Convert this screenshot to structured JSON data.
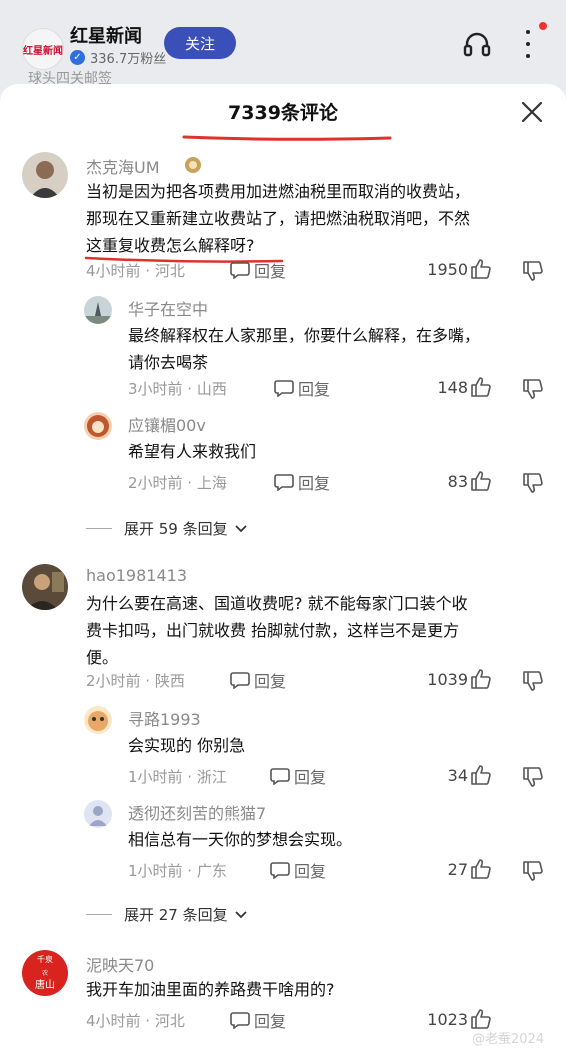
{
  "header": {
    "logo_text": "红星新闻",
    "app_name": "红星新闻",
    "fans": "336.7万粉丝",
    "follow_label": "关注",
    "behind_text": "球头四关邮签"
  },
  "sheet": {
    "title": "7339条评论"
  },
  "comments": [
    {
      "user": "杰克海UM",
      "text_lines": [
        "当初是因为把各项费用加进燃油税里而取消的收费站，",
        "那现在又重新建立收费站了，请把燃油税取消吧，不然",
        "这重复收费怎么解释呀?"
      ],
      "time": "4小时前 · 河北",
      "reply_label": "回复",
      "likes": "1950"
    },
    {
      "user": "华子在空中",
      "text_lines": [
        "最终解释权在人家那里，你要什么解释，在多嘴，",
        "请你去喝茶"
      ],
      "time": "3小时前 · 山西",
      "reply_label": "回复",
      "likes": "148"
    },
    {
      "user": "应镶楣00v",
      "text_lines": [
        "希望有人来救我们"
      ],
      "time": "2小时前 · 上海",
      "reply_label": "回复",
      "likes": "83"
    },
    {
      "user": "hao1981413",
      "text_lines": [
        "为什么要在高速、国道收费呢? 就不能每家门口装个收",
        "费卡扣吗，出门就收费 抬脚就付款，这样岂不是更方",
        "便。"
      ],
      "time": "2小时前 · 陕西",
      "reply_label": "回复",
      "likes": "1039"
    },
    {
      "user": "寻路1993",
      "text_lines": [
        "会实现的  你别急"
      ],
      "time": "1小时前 · 浙江",
      "reply_label": "回复",
      "likes": "34"
    },
    {
      "user": "透彻还刻苦的熊猫7",
      "text_lines": [
        "相信总有一天你的梦想会实现。"
      ],
      "time": "1小时前 · 广东",
      "reply_label": "回复",
      "likes": "27"
    },
    {
      "user": "泥映天70",
      "text_lines": [
        "我开车加油里面的养路费干啥用的?"
      ],
      "time": "4小时前 · 河北",
      "reply_label": "回复",
      "likes": "1023"
    }
  ],
  "expand": [
    {
      "label": "展开 59 条回复"
    },
    {
      "label": "展开 27 条回复"
    }
  ],
  "avatar_texts": {
    "tang_top": "千泉",
    "tang_mid": "农",
    "tang_bottom": "唐山"
  },
  "watermark": "@老蚕2024",
  "colors": {
    "follow": "#3b4fb8",
    "underline": "#e0312b",
    "meta": "#999999"
  }
}
